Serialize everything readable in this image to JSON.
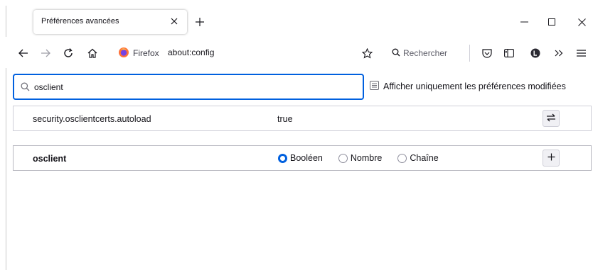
{
  "tab": {
    "title": "Préférences avancées"
  },
  "navbar": {
    "identity_label": "Firefox",
    "url": "about:config",
    "search_placeholder": "Rechercher"
  },
  "config": {
    "search_value": "osclient",
    "show_modified_label": "Afficher uniquement les préférences modifiées",
    "rows": [
      {
        "name": "security.osclientcerts.autoload",
        "value": "true"
      }
    ],
    "new_pref": {
      "name": "osclient",
      "types": [
        "Booléen",
        "Nombre",
        "Chaîne"
      ],
      "selected_type": "Booléen"
    }
  },
  "colors": {
    "accent": "#0060df",
    "firefox_orange": "#ff7139"
  }
}
